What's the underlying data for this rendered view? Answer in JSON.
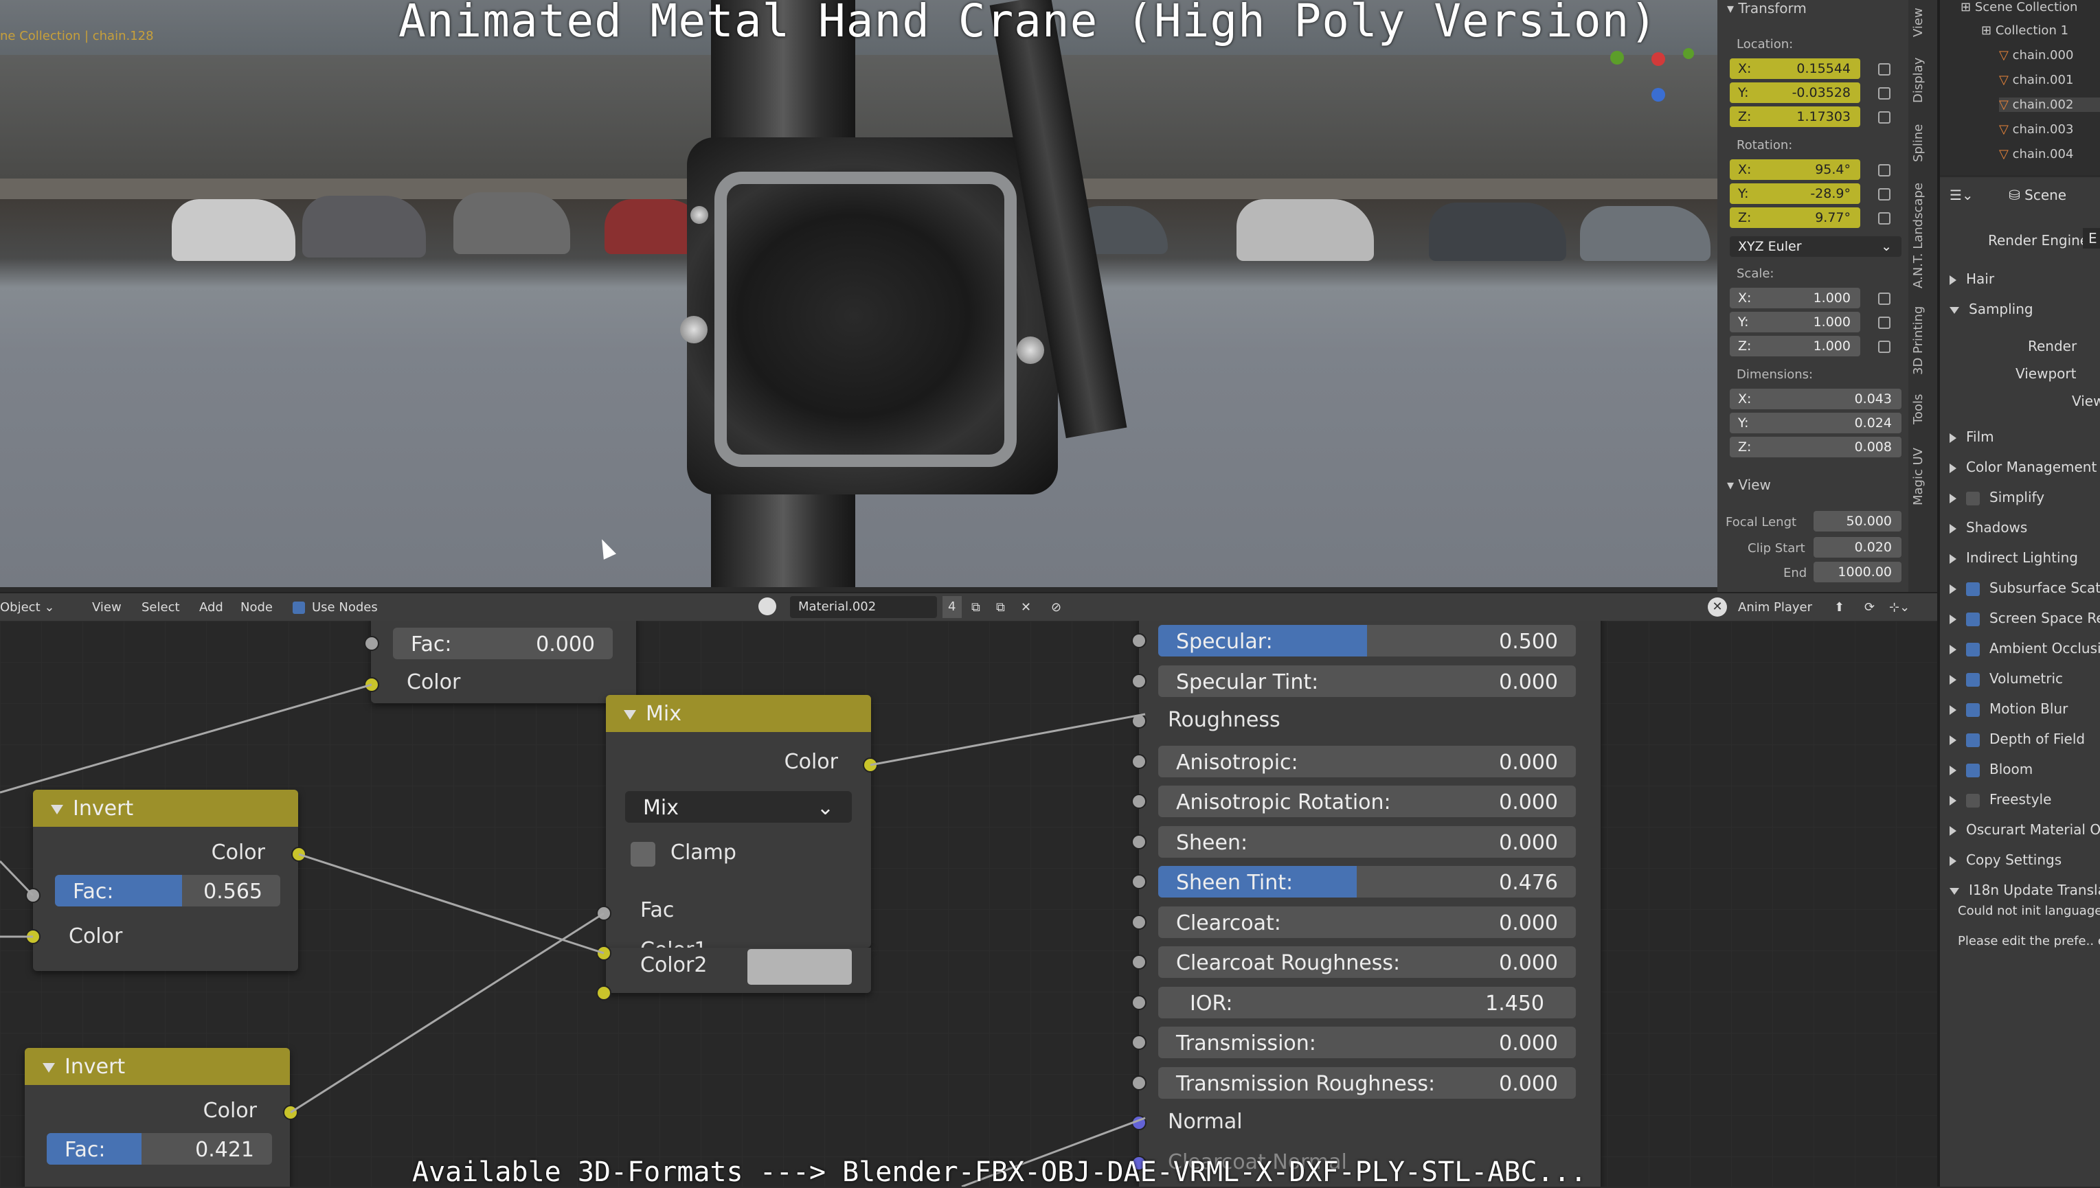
{
  "video": {
    "title": "Animated Metal Hand Crane (High Poly Version)",
    "footer": "Available 3D-Formats ---> Blender-FBX-OBJ-DAE-VRML-X-DXF-PLY-STL-ABC..."
  },
  "viewport": {
    "breadcrumb": "ne Collection | chain.128"
  },
  "node_header": {
    "mode": "Object",
    "menus": [
      "View",
      "Select",
      "Add",
      "Node"
    ],
    "use_nodes_label": "Use Nodes",
    "material_name": "Material.002",
    "user_count": "4",
    "anim_player": "Anim Player"
  },
  "nodes": {
    "top_fragment": {
      "fac_label": "Fac:",
      "fac_value": "0.000",
      "color_label": "Color"
    },
    "invert1": {
      "title": "Invert",
      "out_color": "Color",
      "fac_label": "Fac:",
      "fac_value": "0.565",
      "fac_fraction": 0.565,
      "in_color": "Color"
    },
    "invert2": {
      "title": "Invert",
      "out_color": "Color",
      "fac_label": "Fac:",
      "fac_value": "0.421",
      "fac_fraction": 0.421
    },
    "mix": {
      "title": "Mix",
      "out_color": "Color",
      "blend_mode": "Mix",
      "clamp_label": "Clamp",
      "fac": "Fac",
      "color1": "Color1",
      "color2": "Color2"
    },
    "principled": {
      "rows": [
        {
          "label": "Specular:",
          "value": "0.500",
          "fraction": 0.5,
          "type": "field"
        },
        {
          "label": "Specular Tint:",
          "value": "0.000",
          "fraction": 0,
          "type": "field"
        },
        {
          "label": "Roughness",
          "value": "",
          "type": "socket"
        },
        {
          "label": "Anisotropic:",
          "value": "0.000",
          "fraction": 0,
          "type": "field"
        },
        {
          "label": "Anisotropic Rotation:",
          "value": "0.000",
          "fraction": 0,
          "type": "field"
        },
        {
          "label": "Sheen:",
          "value": "0.000",
          "fraction": 0,
          "type": "field"
        },
        {
          "label": "Sheen Tint:",
          "value": "0.476",
          "fraction": 0.476,
          "type": "field"
        },
        {
          "label": "Clearcoat:",
          "value": "0.000",
          "fraction": 0,
          "type": "field"
        },
        {
          "label": "Clearcoat Roughness:",
          "value": "0.000",
          "fraction": 0,
          "type": "field"
        },
        {
          "label": "IOR:",
          "value": "1.450",
          "fraction": 0,
          "type": "field"
        },
        {
          "label": "Transmission:",
          "value": "0.000",
          "fraction": 0,
          "type": "field"
        },
        {
          "label": "Transmission Roughness:",
          "value": "0.000",
          "fraction": 0,
          "type": "field"
        },
        {
          "label": "Normal",
          "value": "",
          "type": "socket"
        },
        {
          "label": "Clearcoat Normal",
          "value": "",
          "type": "socket"
        }
      ]
    }
  },
  "transform": {
    "header": "Transform",
    "location_label": "Location:",
    "location": {
      "x": "0.15544",
      "y": "-0.03528",
      "z": "1.17303"
    },
    "rotation_label": "Rotation:",
    "rotation": {
      "x": "95.4°",
      "y": "-28.9°",
      "z": "9.77°"
    },
    "rotation_mode": "XYZ Euler",
    "scale_label": "Scale:",
    "scale": {
      "x": "1.000",
      "y": "1.000",
      "z": "1.000"
    },
    "dimensions_label": "Dimensions:",
    "dimensions": {
      "x": "0.043",
      "y": "0.024",
      "z": "0.008"
    },
    "view_header": "View",
    "focal_label": "Focal Lengt",
    "focal_value": "50.000",
    "clip_start_label": "Clip Start",
    "clip_start_value": "0.020",
    "clip_end_label": "End",
    "clip_end_value": "1000.00"
  },
  "side_tabs": [
    "View",
    "Display",
    "Spline",
    "A.N.T. Landscape",
    "3D Printing",
    "Tools",
    "Magic UV"
  ],
  "outliner": {
    "root": "Scene Collection",
    "collection": "Collection 1",
    "items": [
      "chain.000",
      "chain.001",
      "chain.002",
      "chain.003",
      "chain.004"
    ]
  },
  "render_props": {
    "scene_label": "Scene",
    "render_engine_label": "Render Engine",
    "render_engine_value": "E",
    "panels": [
      {
        "label": "Hair",
        "kind": "collapsed"
      },
      {
        "label": "Sampling",
        "kind": "expanded"
      }
    ],
    "sampling_render": "Render",
    "sampling_viewport": "Viewport",
    "sampling_viewp": "Viewp",
    "sections": [
      {
        "label": "Film",
        "check": null
      },
      {
        "label": "Color Management",
        "check": null
      },
      {
        "label": "Simplify",
        "check": false
      },
      {
        "label": "Shadows",
        "check": null
      },
      {
        "label": "Indirect Lighting",
        "check": null
      },
      {
        "label": "Subsurface Scat",
        "check": true
      },
      {
        "label": "Screen Space Re",
        "check": true
      },
      {
        "label": "Ambient Occlusi",
        "check": true
      },
      {
        "label": "Volumetric",
        "check": true
      },
      {
        "label": "Motion Blur",
        "check": true
      },
      {
        "label": "Depth of Field",
        "check": true
      },
      {
        "label": "Bloom",
        "check": true
      },
      {
        "label": "Freestyle",
        "check": false
      },
      {
        "label": "Oscurart Material O",
        "check": null
      },
      {
        "label": "Copy Settings",
        "check": null
      },
      {
        "label": "I18n Update Transla",
        "check": null,
        "expanded": true
      }
    ],
    "msg1": "Could not init language",
    "msg2": "Please edit the prefe.. e"
  },
  "colors": {
    "accent_blue": "#4772b3",
    "node_header": "#9c902a",
    "socket_yellow": "#c9c42b",
    "field_yellow": "#b9b42a"
  }
}
